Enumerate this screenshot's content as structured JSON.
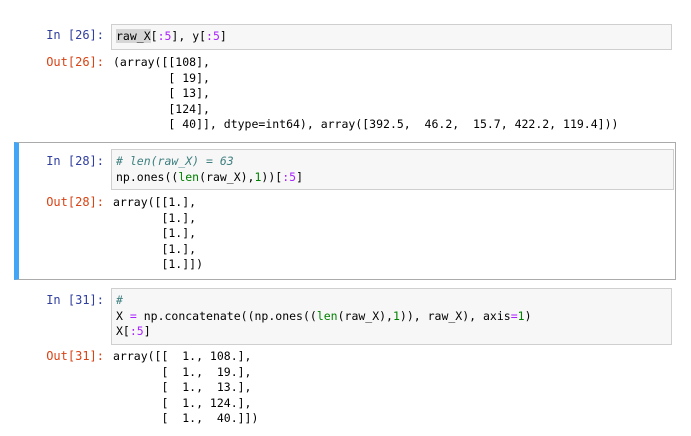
{
  "cells": [
    {
      "in_prompt": "In [26]:",
      "out_prompt": "Out[26]:",
      "code": {
        "highlight": "raw_X",
        "rest1": "[",
        "slice": ":5",
        "rest2": "], y[",
        "slice2": ":5",
        "rest3": "]"
      },
      "output": "(array([[108],\n        [ 19],\n        [ 13],\n        [124],\n        [ 40]], dtype=int64), array([392.5,  46.2,  15.7, 422.2, 119.4]))"
    },
    {
      "in_prompt": "In [28]:",
      "out_prompt": "Out[28]:",
      "code": {
        "comment": "# len(raw_X) = 63",
        "l2a": "np.ones((",
        "l2_len": "len",
        "l2b": "(raw_X),",
        "l2_one": "1",
        "l2c": "))[",
        "l2_slice": ":5",
        "l2d": "]"
      },
      "output": "array([[1.],\n       [1.],\n       [1.],\n       [1.],\n       [1.]])"
    },
    {
      "in_prompt": "In [31]:",
      "out_prompt": "Out[31]:",
      "code": {
        "comment": "#",
        "l2a": "X ",
        "l2_eq": "=",
        "l2b": " np.concatenate((np.ones((",
        "l2_len": "len",
        "l2c": "(raw_X),",
        "l2_one": "1",
        "l2d": ")), raw_X), axis",
        "l2_eq2": "=",
        "l2_one2": "1",
        "l2e": ")",
        "l3a": "X[",
        "l3_slice": ":5",
        "l3b": "]"
      },
      "output": "array([[  1., 108.],\n       [  1.,  19.],\n       [  1.,  13.],\n       [  1., 124.],\n       [  1.,  40.]])"
    }
  ],
  "colors": {
    "in_prompt": "#303f9f",
    "out_prompt": "#d84315",
    "selected_border": "#42a5f5",
    "code_bg": "#f7f7f7"
  }
}
